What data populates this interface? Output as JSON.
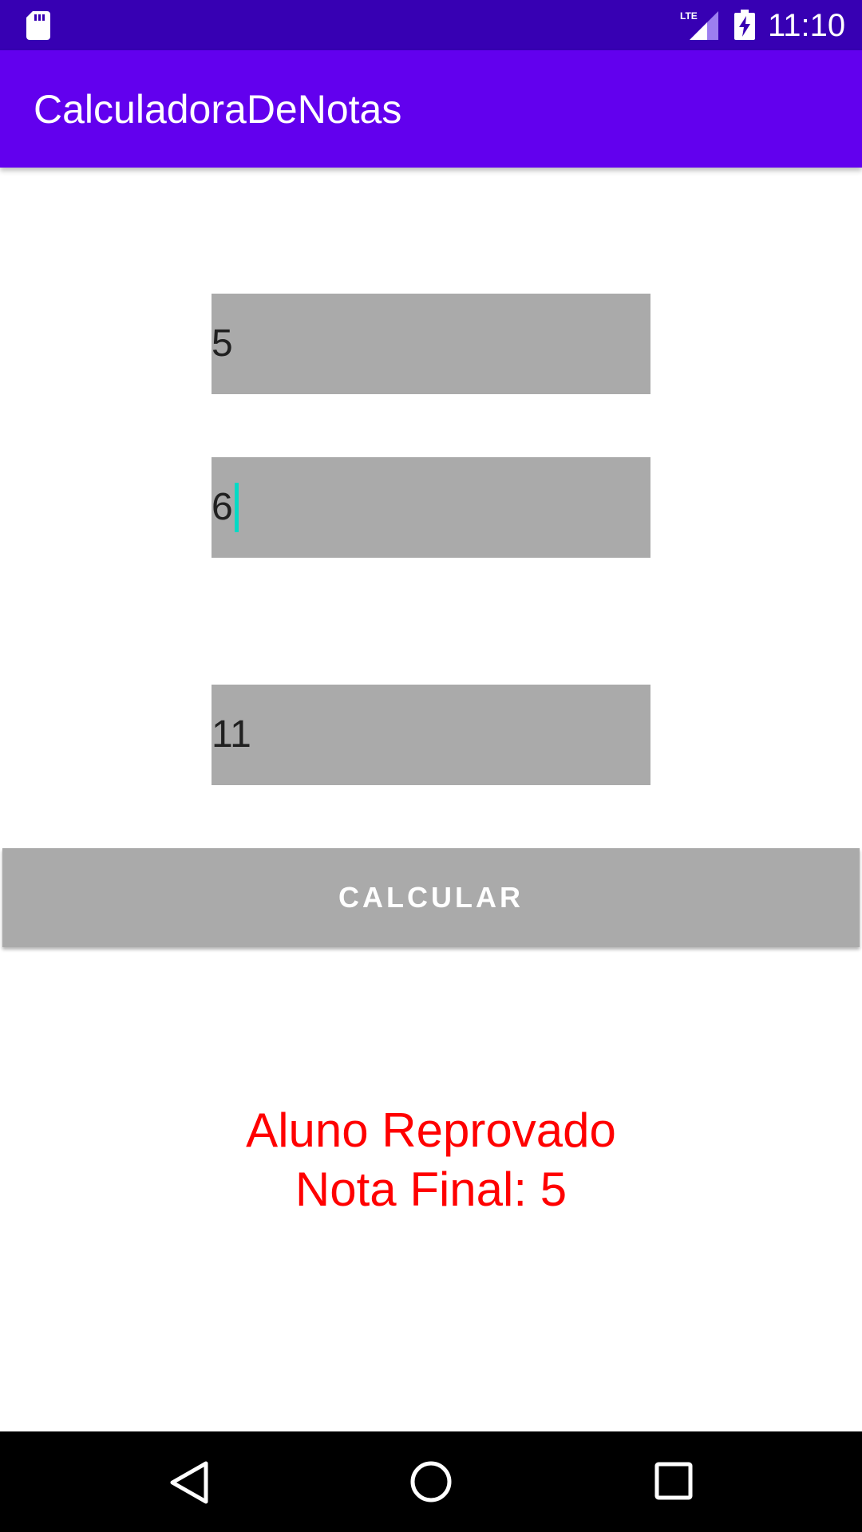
{
  "status_bar": {
    "time": "11:10",
    "network": "LTE",
    "icons": [
      "sd-card-icon",
      "lte-signal-icon",
      "battery-charging-icon"
    ]
  },
  "app_bar": {
    "title": "CalculadoraDeNotas"
  },
  "form": {
    "field1_value": "5",
    "field2_value": "6",
    "field3_value": "11",
    "calculate_label": "CALCULAR"
  },
  "result": {
    "status": "Aluno Reprovado",
    "final_grade": "Nota Final: 5"
  },
  "nav_bar": {
    "icons": [
      "back-icon",
      "home-icon",
      "recents-icon"
    ]
  },
  "colors": {
    "status_bar": "#3700b3",
    "app_bar": "#6200ee",
    "field_bg": "#aaaaaa",
    "caret": "#03dac5",
    "result_text": "#ff0000"
  }
}
